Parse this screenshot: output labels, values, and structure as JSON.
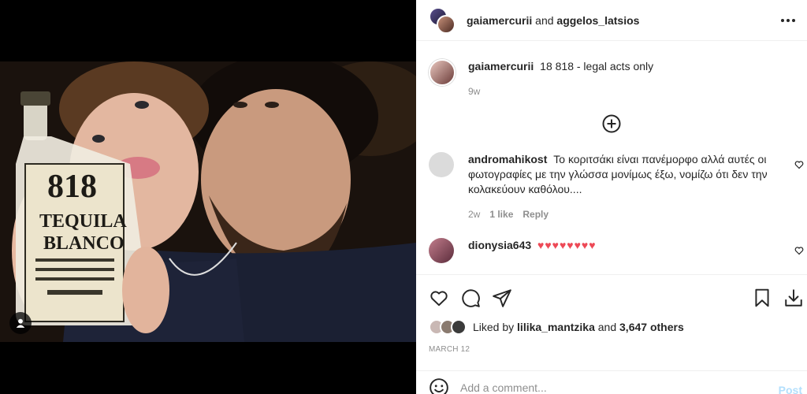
{
  "header": {
    "user1": "gaiamercurii",
    "joiner": "and",
    "user2": "aggelos_latsios",
    "more_icon": "more-horizontal-icon"
  },
  "caption": {
    "username": "gaiamercurii",
    "text": "18 818 - legal acts only",
    "time": "9w"
  },
  "load_more_icon": "plus-circle-icon",
  "comments": [
    {
      "username": "andromahikost",
      "text": "Το κοριτσάκι είναι πανέμορφο αλλά αυτές οι φωτογραφίες με την γλώσσα μονίμως έξω, νομίζω ότι δεν την κολακεύουν καθόλου....",
      "time": "2w",
      "likes": "1 like",
      "reply": "Reply"
    },
    {
      "username": "dionysia643",
      "text": "♥♥♥♥♥♥♥♥"
    }
  ],
  "actions": {
    "like_icon": "heart-icon",
    "comment_icon": "comment-icon",
    "share_icon": "paper-plane-icon",
    "save_icon": "bookmark-icon",
    "download_icon": "download-icon"
  },
  "likes": {
    "prefix": "Liked by",
    "user": "lilika_mantzika",
    "joiner": "and",
    "count": "3,647 others"
  },
  "date": "MARCH 12",
  "composer": {
    "placeholder": "Add a comment...",
    "post_label": "Post"
  },
  "photo": {
    "bottle_brand": "818",
    "bottle_line1": "TEQUILA",
    "bottle_line2": "BLANCO"
  },
  "colors": {
    "accent_red": "#ed4956",
    "post_disabled": "#b2dffc",
    "muted": "#8e8e8e"
  }
}
